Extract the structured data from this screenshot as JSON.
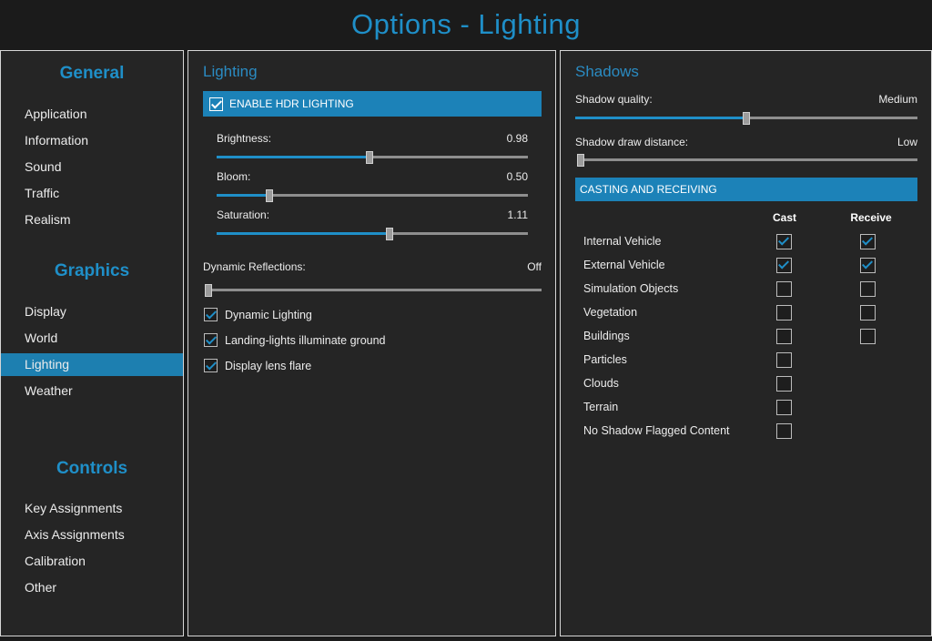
{
  "title": "Options - Lighting",
  "sidebar": {
    "sections": [
      {
        "title": "General",
        "items": [
          "Application",
          "Information",
          "Sound",
          "Traffic",
          "Realism"
        ]
      },
      {
        "title": "Graphics",
        "items": [
          "Display",
          "World",
          "Lighting",
          "Weather"
        ]
      },
      {
        "title": "Controls",
        "items": [
          "Key Assignments",
          "Axis Assignments",
          "Calibration",
          "Other"
        ]
      }
    ],
    "active_item": "Lighting"
  },
  "lighting": {
    "heading": "Lighting",
    "hdr": {
      "label": "ENABLE HDR LIGHTING",
      "checked": true
    },
    "sliders": [
      {
        "label": "Brightness:",
        "value": "0.98",
        "fraction": 0.49
      },
      {
        "label": "Bloom:",
        "value": "0.50",
        "fraction": 0.17
      },
      {
        "label": "Saturation:",
        "value": "1.11",
        "fraction": 0.555
      }
    ],
    "reflections": {
      "label": "Dynamic Reflections:",
      "value": "Off",
      "fraction": 0.0
    },
    "checkboxes": [
      {
        "label": "Dynamic Lighting",
        "checked": true
      },
      {
        "label": "Landing-lights illuminate ground",
        "checked": true
      },
      {
        "label": "Display lens flare",
        "checked": true
      }
    ]
  },
  "shadows": {
    "heading": "Shadows",
    "quality": {
      "label": "Shadow quality:",
      "value": "Medium",
      "fraction": 0.5
    },
    "distance": {
      "label": "Shadow draw distance:",
      "value": "Low",
      "fraction": 0.0
    },
    "casting_header": "CASTING AND RECEIVING",
    "col_cast": "Cast",
    "col_receive": "Receive",
    "rows": [
      {
        "label": "Internal Vehicle",
        "cast": true,
        "receive": true
      },
      {
        "label": "External Vehicle",
        "cast": true,
        "receive": true
      },
      {
        "label": "Simulation Objects",
        "cast": false,
        "receive": false
      },
      {
        "label": "Vegetation",
        "cast": false,
        "receive": false
      },
      {
        "label": "Buildings",
        "cast": false,
        "receive": false
      },
      {
        "label": "Particles",
        "cast": false,
        "receive": null
      },
      {
        "label": "Clouds",
        "cast": false,
        "receive": null
      },
      {
        "label": "Terrain",
        "cast": false,
        "receive": null
      },
      {
        "label": "No Shadow Flagged Content",
        "cast": false,
        "receive": null
      }
    ]
  },
  "colors": {
    "accent": "#1f8fc8",
    "bar": "#1c82b8",
    "background": "#1b1b1b",
    "panel": "#252525"
  }
}
